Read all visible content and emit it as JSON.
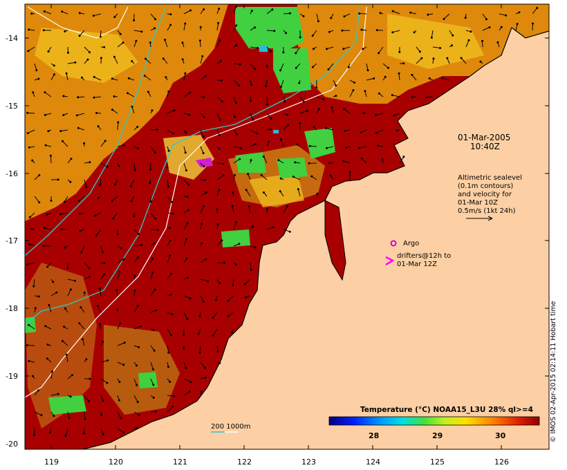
{
  "map": {
    "timestamp_line1": "01-Mar-2005",
    "timestamp_line2": "10:40Z",
    "sealevel_note": [
      "Altimetric sealevel",
      "(0.1m contours)",
      "and velocity for",
      "01-Mar 10Z",
      "0.5m/s (1kt 24h)"
    ],
    "argo_label": "Argo",
    "drifters_label_1": "drifters@12h to",
    "drifters_label_2": "01-Mar 12Z",
    "bathy_label": "200  1000m",
    "colorbar_title": "Temperature (°C) NOAA15_L3U 28% ql>=4",
    "colorbar_ticks": [
      "28",
      "29",
      "30"
    ],
    "credit": "© IMOS 02-Apr-2015 02:14:11 Hobart time",
    "lat_ticks": [
      "-14",
      "-15",
      "-16",
      "-17",
      "-18",
      "-19",
      "-20"
    ],
    "lon_ticks": [
      "119",
      "120",
      "121",
      "122",
      "123",
      "124",
      "125",
      "126"
    ],
    "colors": {
      "land": "#fcd0a4",
      "warm_sst": "#a80000",
      "mid_sst": "#e89a10",
      "cool_sst": "#40d040",
      "contour_200m": "#30c8c8",
      "contour_1000m": "#ffffff",
      "argo": "#d000d0",
      "drifter": "#ff00ff"
    }
  }
}
